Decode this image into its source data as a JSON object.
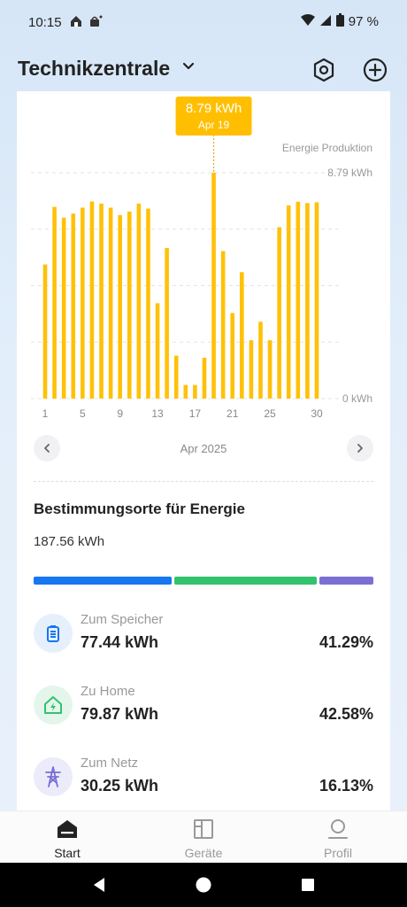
{
  "status_bar": {
    "time": "10:15",
    "battery": "97 %",
    "icons": [
      "home-app-icon",
      "shopping-notification-icon",
      "wifi-icon",
      "signal-icon",
      "battery-icon"
    ]
  },
  "header": {
    "title": "Technikzentrale",
    "icons": [
      "chevron-down-icon",
      "hexagon-settings-icon",
      "plus-circle-icon"
    ]
  },
  "chart_data": {
    "type": "bar",
    "title": "Energie Produktion",
    "bar_color": "#ffc107",
    "categories": [
      "1",
      "2",
      "3",
      "4",
      "5",
      "6",
      "7",
      "8",
      "9",
      "10",
      "11",
      "12",
      "13",
      "14",
      "15",
      "16",
      "17",
      "18",
      "19",
      "20",
      "21",
      "22",
      "23",
      "24",
      "25",
      "26",
      "27",
      "28",
      "29",
      "30"
    ],
    "x_tick_labels": [
      "1",
      "5",
      "9",
      "13",
      "17",
      "21",
      "25",
      "30"
    ],
    "values": [
      5.22,
      7.46,
      7.04,
      7.2,
      7.43,
      7.67,
      7.59,
      7.43,
      7.14,
      7.28,
      7.59,
      7.39,
      3.71,
      5.86,
      1.67,
      0.53,
      0.53,
      1.59,
      8.79,
      5.74,
      3.33,
      4.92,
      2.27,
      2.99,
      2.27,
      6.67,
      7.52,
      7.66,
      7.61,
      7.64
    ],
    "ylim": [
      0,
      8.79
    ],
    "y_tick_labels": [
      "8.79 kWh",
      "0 kWh"
    ],
    "grid": true,
    "tooltip": {
      "value": "8.79 kWh",
      "date": "Apr 19",
      "index": 18
    }
  },
  "month_nav": {
    "label": "Apr 2025",
    "icons": [
      "chevron-left-icon",
      "chevron-right-icon"
    ]
  },
  "destinations": {
    "title": "Bestimmungsorte für Energie",
    "total": "187.56 kWh",
    "items": [
      {
        "label": "Zum Speicher",
        "value": "77.44 kWh",
        "percent": "41.29%",
        "fraction": 0.4129,
        "color": "#1677f0",
        "icon_bg": "#e6f0fc",
        "icon": "battery-icon"
      },
      {
        "label": "Zu Home",
        "value": "79.87 kWh",
        "percent": "42.58%",
        "fraction": 0.4258,
        "color": "#33c26d",
        "icon_bg": "#e4f6ec",
        "icon": "home-bolt-icon"
      },
      {
        "label": "Zum Netz",
        "value": "30.25 kWh",
        "percent": "16.13%",
        "fraction": 0.1613,
        "color": "#7b6fd6",
        "icon_bg": "#ecebfa",
        "icon": "power-tower-icon"
      }
    ]
  },
  "bottom_nav": {
    "items": [
      {
        "label": "Start",
        "icon": "home-icon",
        "active": true
      },
      {
        "label": "Geräte",
        "icon": "devices-icon",
        "active": false
      },
      {
        "label": "Profil",
        "icon": "profile-icon",
        "active": false
      }
    ]
  }
}
